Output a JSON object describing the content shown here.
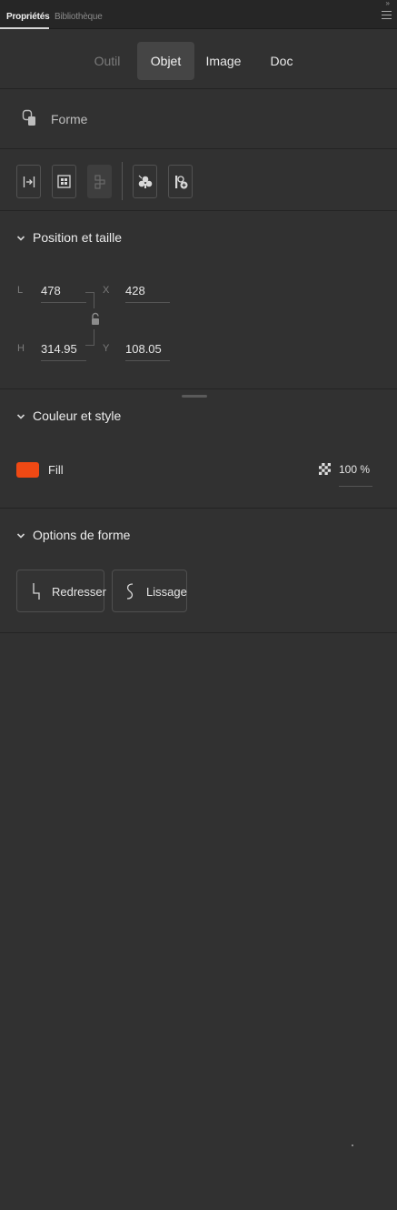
{
  "tabs": [
    {
      "label": "Propriétés",
      "active": true
    },
    {
      "label": "Bibliothèque",
      "active": false
    }
  ],
  "modes": {
    "outil": "Outil",
    "objet": "Objet",
    "image": "Image",
    "doc": "Doc",
    "selected": "Objet"
  },
  "object_type": {
    "icon": "shape-icon",
    "label": "Forme"
  },
  "tool_buttons": [
    {
      "icon": "align-icon",
      "enabled": true
    },
    {
      "icon": "distribute-icon",
      "enabled": true
    },
    {
      "icon": "match-size-icon",
      "enabled": false
    },
    {
      "icon": "convert-symbol-icon",
      "enabled": true
    },
    {
      "icon": "add-symbol-icon",
      "enabled": true
    }
  ],
  "position_section": {
    "title": "Position et taille",
    "w_label": "L",
    "w_value": "478",
    "x_label": "X",
    "x_value": "428",
    "h_label": "H",
    "h_value": "314.95",
    "y_label": "Y",
    "y_value": "108.05",
    "lock_icon": "unlocked-icon"
  },
  "color_section": {
    "title": "Couleur et style",
    "fill_label": "Fill",
    "fill_color": "#ef4914",
    "opacity": "100 %"
  },
  "shape_options": {
    "title": "Options de forme",
    "redresser": "Redresser",
    "lissage": "Lissage"
  }
}
